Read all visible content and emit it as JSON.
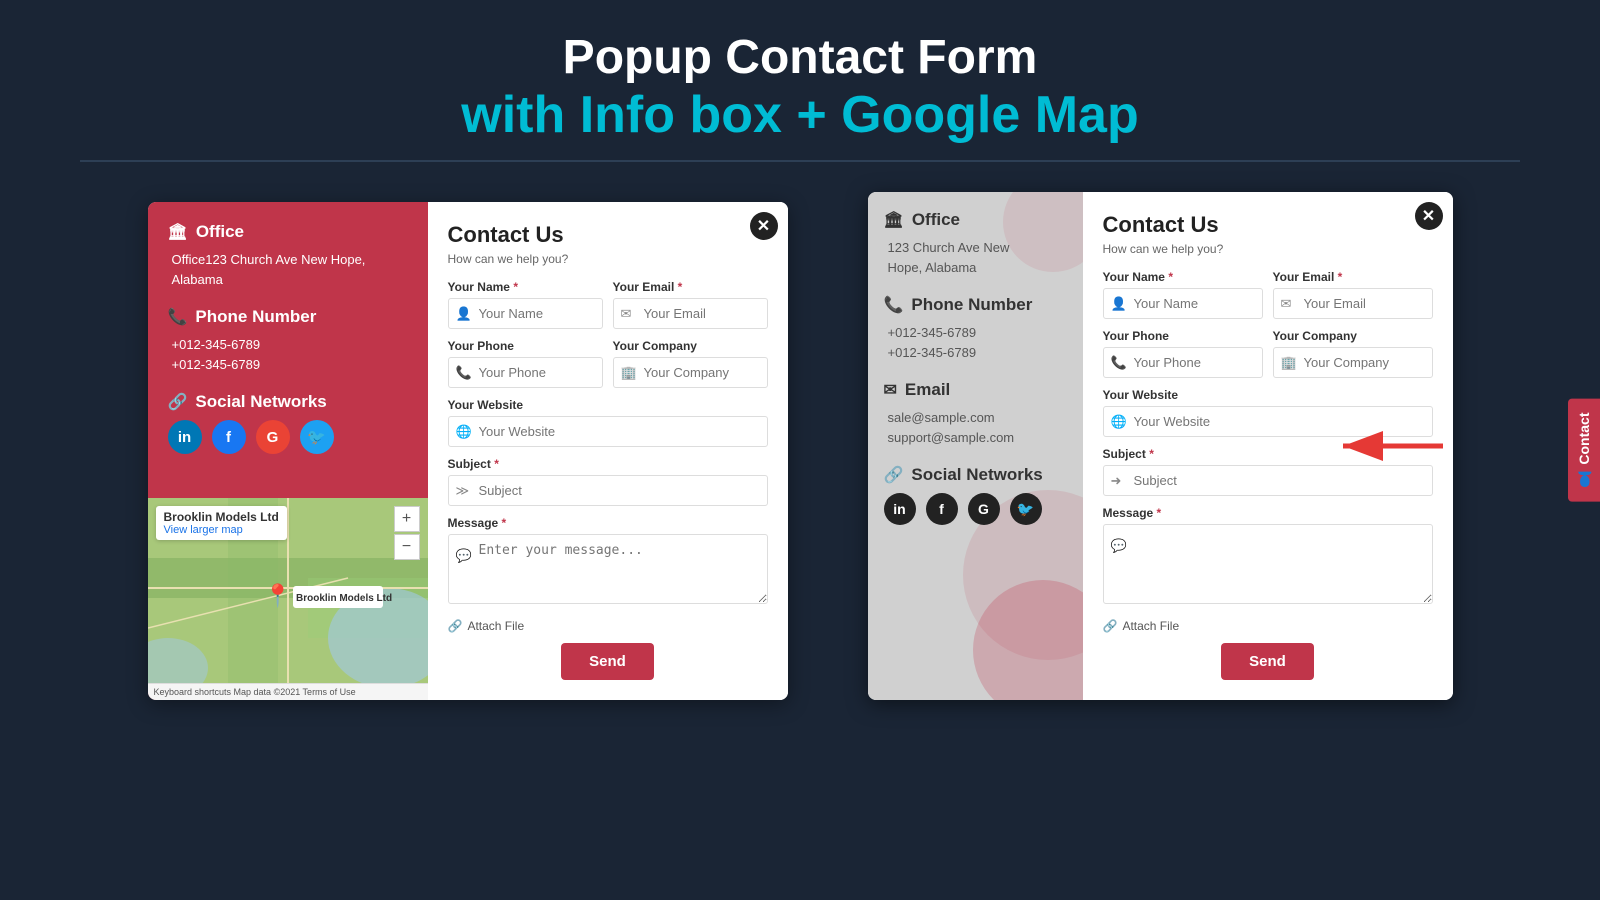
{
  "header": {
    "line1": "Popup Contact Form",
    "line2": "with Info box + Google Map"
  },
  "left_popup": {
    "close_label": "✕",
    "info": {
      "office_title": "Office",
      "office_address": "Office123 Church Ave New Hope, Alabama",
      "phone_title": "Phone Number",
      "phone1": "+012-345-6789",
      "phone2": "+012-345-6789",
      "social_title": "Social Networks"
    },
    "map": {
      "company": "Brooklin Models Ltd",
      "view_link": "View larger map",
      "zoom_in": "+",
      "zoom_out": "−",
      "footer": "Keyboard shortcuts  Map data ©2021  Terms of Use"
    },
    "form": {
      "title": "Contact Us",
      "subtitle": "How can we help you?",
      "name_label": "Your Name",
      "name_placeholder": "Your Name",
      "email_label": "Your Email",
      "email_placeholder": "Your Email",
      "phone_label": "Your Phone",
      "phone_placeholder": "Your Phone",
      "company_label": "Your Company",
      "company_placeholder": "Your Company",
      "website_label": "Your Website",
      "website_placeholder": "Your Website",
      "subject_label": "Subject",
      "subject_placeholder": "Subject",
      "message_label": "Message",
      "message_placeholder": "Enter your message...",
      "attach_label": "Attach File",
      "send_label": "Send"
    }
  },
  "right_popup": {
    "close_label": "✕",
    "info": {
      "office_title": "Office",
      "office_address1": "123 Church Ave New",
      "office_address2": "Hope, Alabama",
      "phone_title": "Phone Number",
      "phone1": "+012-345-6789",
      "phone2": "+012-345-6789",
      "email_title": "Email",
      "email1": "sale@sample.com",
      "email2": "support@sample.com",
      "social_title": "Social Networks"
    },
    "form": {
      "title": "Contact Us",
      "subtitle": "How can we help you?",
      "name_label": "Your Name",
      "name_placeholder": "Your Name",
      "email_label": "Your Email",
      "email_placeholder": "Your Email",
      "phone_label": "Your Phone",
      "phone_placeholder": "Your Phone",
      "company_label": "Your Company",
      "company_placeholder": "Your Company",
      "website_label": "Your Website",
      "website_placeholder": "Your Website",
      "subject_label": "Subject",
      "subject_placeholder": "Subject",
      "message_label": "Message",
      "message_placeholder": "",
      "attach_label": "Attach File",
      "send_label": "Send"
    }
  },
  "contact_tab": {
    "label": "Contact",
    "icon": "👤"
  }
}
